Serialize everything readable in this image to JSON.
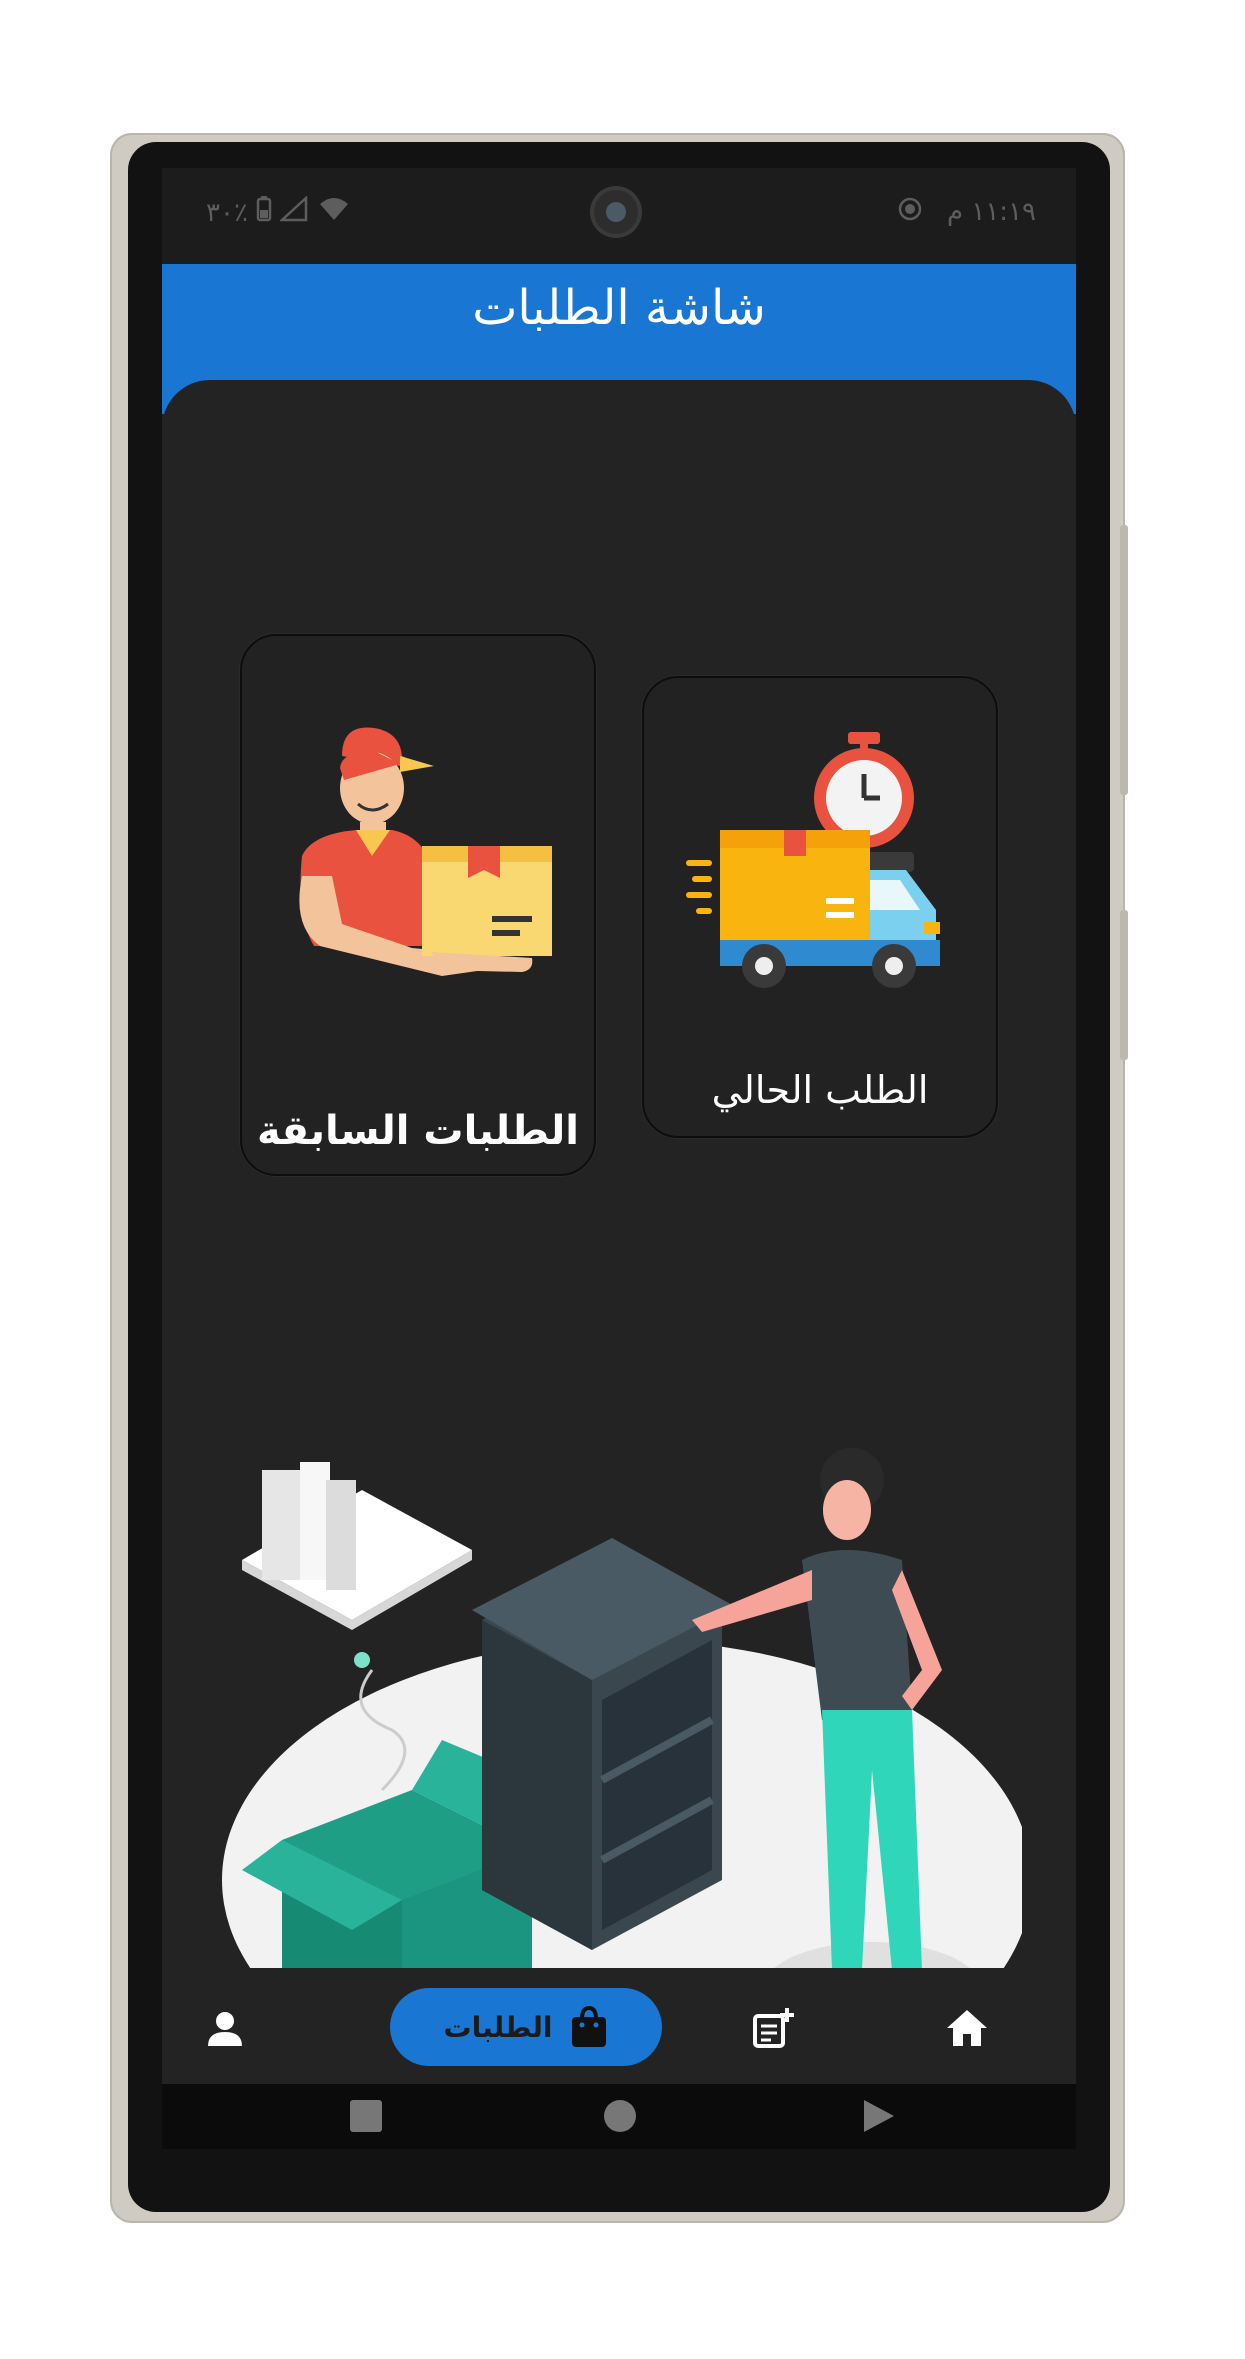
{
  "status_bar": {
    "time": "١١:١٩ م",
    "battery": "٣٠٪"
  },
  "app_bar": {
    "title": "شاشة الطلبات"
  },
  "cards": {
    "current_order": {
      "label": "الطلب الحالي"
    },
    "previous_orders": {
      "label": "الطلبات السابقة"
    }
  },
  "bottom_nav": {
    "items": [
      {
        "icon": "home-icon",
        "label": ""
      },
      {
        "icon": "add-note-icon",
        "label": ""
      },
      {
        "icon": "shopping-bag-icon",
        "label": "الطلبات",
        "active": true
      },
      {
        "icon": "person-icon",
        "label": ""
      }
    ]
  },
  "colors": {
    "primary": "#1976d2",
    "background": "#232323",
    "teal_box": "#1f9e86",
    "pants": "#2fd6b9"
  }
}
